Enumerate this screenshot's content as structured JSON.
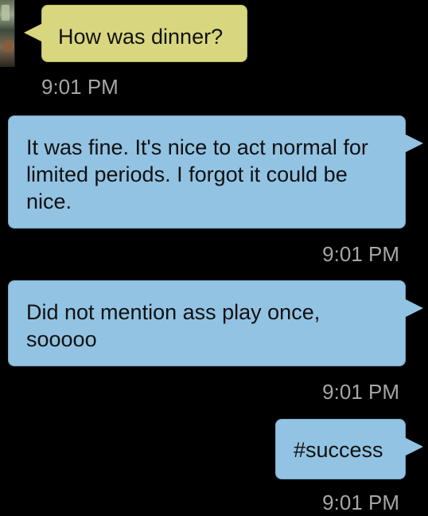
{
  "colors": {
    "background": "#000000",
    "incoming_bubble": "#d8d77f",
    "outgoing_bubble": "#92c3e3",
    "message_text": "#111111",
    "timestamp_text": "#a6a6a6"
  },
  "contact": {
    "avatar_icon": "contact-photo"
  },
  "messages": [
    {
      "direction": "incoming",
      "text": "How was dinner?",
      "time": "9:01 PM"
    },
    {
      "direction": "outgoing",
      "text": "It was fine. It's nice to act normal for limited periods. I forgot it could be nice.",
      "time": "9:01 PM"
    },
    {
      "direction": "outgoing",
      "text": "Did not mention ass play once, sooooo",
      "time": "9:01 PM"
    },
    {
      "direction": "outgoing",
      "text": "#success",
      "time": "9:01 PM"
    }
  ]
}
